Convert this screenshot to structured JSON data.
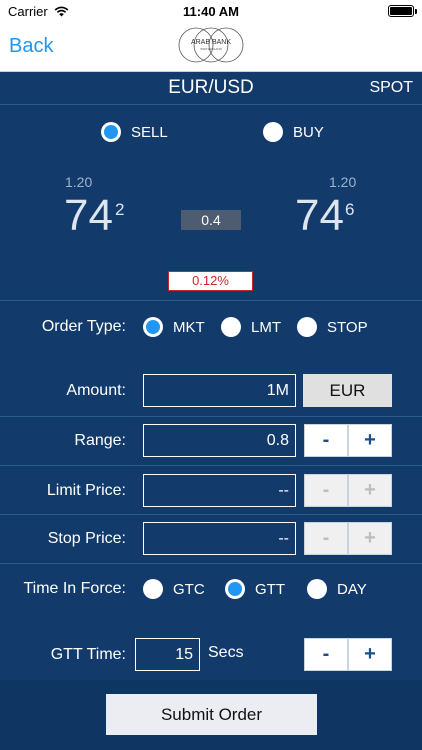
{
  "status": {
    "carrier": "Carrier",
    "time": "11:40 AM"
  },
  "nav": {
    "back_label": "Back",
    "logo_text_top": "ARAB BANK",
    "logo_text_bottom": "SWITZERLAND"
  },
  "header": {
    "pair": "EUR/USD",
    "mode": "SPOT"
  },
  "side": {
    "sell_label": "SELL",
    "buy_label": "BUY",
    "selected": "SELL"
  },
  "quotes": {
    "sell": {
      "handle": "1.20",
      "big": "74",
      "pip": "2"
    },
    "buy": {
      "handle": "1.20",
      "big": "74",
      "pip": "6"
    },
    "spread": "0.4",
    "spread_pct": "0.12%"
  },
  "order_type": {
    "label": "Order Type:",
    "options": [
      "MKT",
      "LMT",
      "STOP"
    ],
    "selected": "MKT"
  },
  "amount": {
    "label": "Amount:",
    "value": "1M",
    "currency": "EUR"
  },
  "range": {
    "label": "Range:",
    "value": "0.8",
    "minus": "-",
    "plus": "+"
  },
  "limit_price": {
    "label": "Limit Price:",
    "value": "--",
    "minus": "-",
    "plus": "+"
  },
  "stop_price": {
    "label": "Stop Price:",
    "value": "--",
    "minus": "-",
    "plus": "+"
  },
  "time_in_force": {
    "label": "Time In Force:",
    "options": [
      "GTC",
      "GTT",
      "DAY"
    ],
    "selected": "GTT"
  },
  "gtt_time": {
    "label": "GTT Time:",
    "value": "15",
    "unit": "Secs",
    "minus": "-",
    "plus": "+"
  },
  "submit_label": "Submit Order",
  "colors": {
    "panel": "#123a6b",
    "accent": "#2196f3",
    "warning": "#c62828"
  }
}
